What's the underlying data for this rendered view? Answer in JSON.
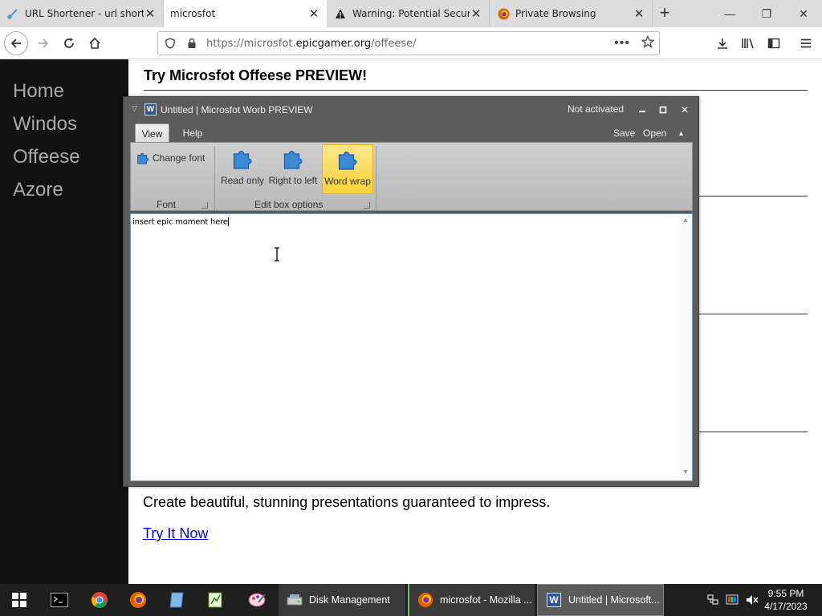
{
  "browser": {
    "tabs": [
      {
        "title": "URL Shortener - url shortene",
        "active": false
      },
      {
        "title": "microsfot",
        "active": true
      },
      {
        "title": "Warning: Potential Security R",
        "active": false
      },
      {
        "title": "Private Browsing",
        "active": false
      }
    ],
    "url_prefix": "https://microsfot.",
    "url_domain": "epicgamer.org",
    "url_path": "/offeese/"
  },
  "site": {
    "nav": [
      "Home",
      "Windos",
      "Offeese",
      "Azore"
    ],
    "heading": "Try Microsfot Offeese PREVIEW!",
    "promo_text": "Create beautiful, stunning presentations guaranteed to impress.",
    "cta_link": "Try It Now"
  },
  "app": {
    "title": "Untitled | Microsfot Worb PREVIEW",
    "status": "Not activated",
    "ribbon_tabs": [
      "View",
      "Help"
    ],
    "commands": {
      "save": "Save",
      "open": "Open"
    },
    "groups": {
      "font": {
        "label": "Font",
        "change_font": "Change font"
      },
      "edit_box": {
        "label": "Edit box options",
        "read_only": "Read only",
        "right_to_left": "Right to left",
        "word_wrap": "Word wrap"
      }
    },
    "document_text": "insert epic moment here"
  },
  "taskbar": {
    "items": [
      {
        "label": "Disk Management"
      },
      {
        "label": "microsfot - Mozilla ..."
      },
      {
        "label": "Untitled | Microsoft..."
      }
    ],
    "time": "9:55 PM",
    "date": "4/17/2023"
  },
  "colors": {
    "sidebar_bg": "#111111",
    "link": "#0000ee",
    "app_frame": "#5c5c5c",
    "word_wrap_active": "#f9d23a",
    "taskbar_bg": "#1f1f1f"
  }
}
